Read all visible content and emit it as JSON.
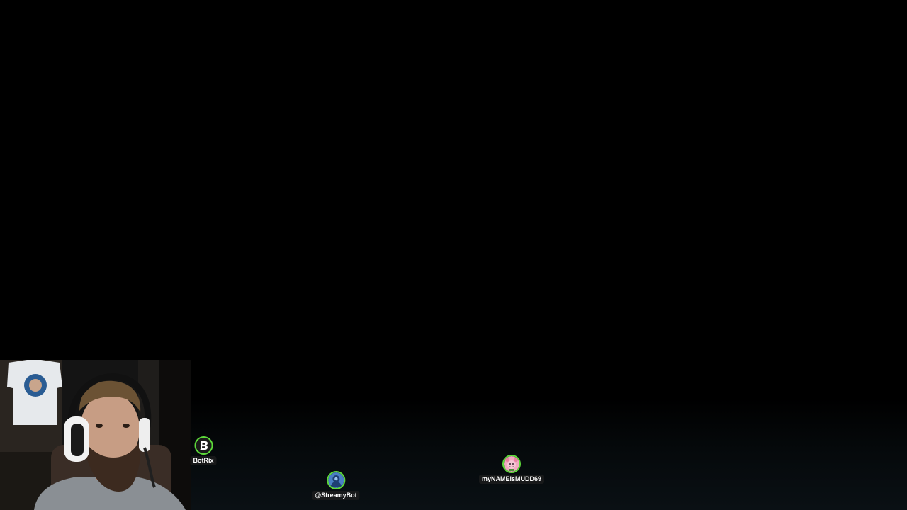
{
  "overlay": {
    "chatters": [
      {
        "name": "BotRix",
        "avatar_icon": "botrix-b-logo-icon",
        "ring_color": "#5dd93a"
      },
      {
        "name": "@StreamyBot",
        "avatar_icon": "streamybot-avatar-icon",
        "ring_color": "#5dd93a"
      },
      {
        "name": "myNAMEisMUDD69",
        "avatar_icon": "pink-character-avatar-icon",
        "ring_color": "#5dd93a"
      }
    ]
  },
  "webcam": {
    "subject": "streamer-with-headset"
  },
  "colors": {
    "background": "#000000",
    "avatar_ring": "#5dd93a",
    "name_pill": "#1e1e1e",
    "name_text": "#ffffff"
  }
}
